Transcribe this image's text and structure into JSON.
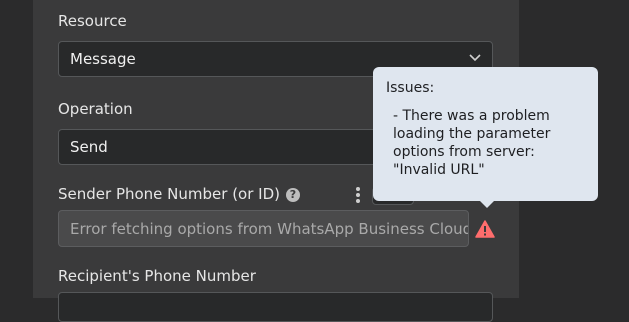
{
  "fields": {
    "resource": {
      "label": "Resource",
      "value": "Message"
    },
    "operation": {
      "label": "Operation",
      "value": "Send"
    },
    "sender": {
      "label": "Sender Phone Number (or ID)",
      "help": "?",
      "error_value": "Error fetching options from WhatsApp Business Cloud Tool"
    },
    "recipient": {
      "label": "Recipient's Phone Number"
    }
  },
  "tooltip": {
    "title": "Issues:",
    "issue": "- There was a problem loading the parameter options from server: \"Invalid URL\""
  },
  "colors": {
    "warning": "#ff6d6d",
    "tooltip_bg": "#dfe6ef",
    "panel_bg": "#3a3a3b"
  }
}
